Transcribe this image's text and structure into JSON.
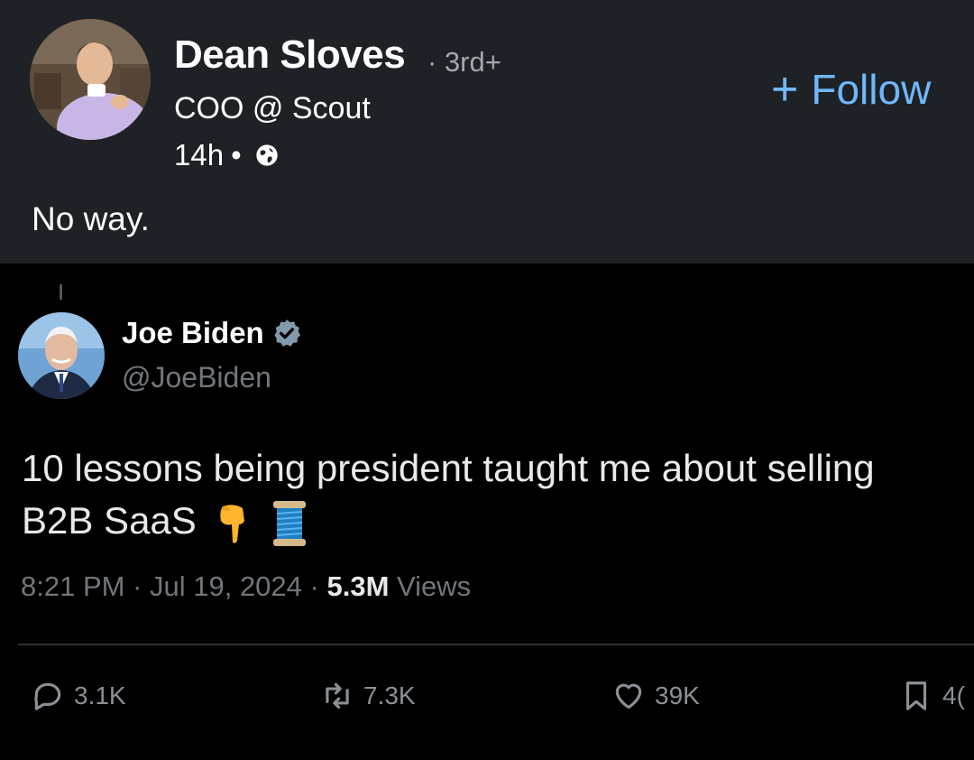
{
  "post": {
    "author": "Dean Sloves",
    "degree": "· 3rd+",
    "headline": "COO @ Scout",
    "time": "14h",
    "dot": "•",
    "follow_label": "Follow",
    "follow_plus": "+",
    "text": "No way."
  },
  "tweet": {
    "name": "Joe Biden",
    "handle": "@JoeBiden",
    "line1": "10 lessons being president taught me about selling",
    "line2": "B2B SaaS",
    "time": "8:21 PM · Jul 19, 2024 · ",
    "views_count": "5.3M",
    "views_label": " Views",
    "replies": "3.1K",
    "reposts": "7.3K",
    "likes": "39K",
    "bookmarks": "4("
  },
  "colors": {
    "linkedin_bg": "#1e2226",
    "follow_blue": "#71b7fb",
    "x_bg": "#000000",
    "x_muted": "#71767b",
    "verified_blue": "#1d9bf0"
  },
  "icons": [
    "globe-icon",
    "verified-badge-icon",
    "pointing-down-emoji",
    "spool-of-thread-emoji",
    "reply-icon",
    "repost-icon",
    "like-icon",
    "bookmark-icon"
  ]
}
